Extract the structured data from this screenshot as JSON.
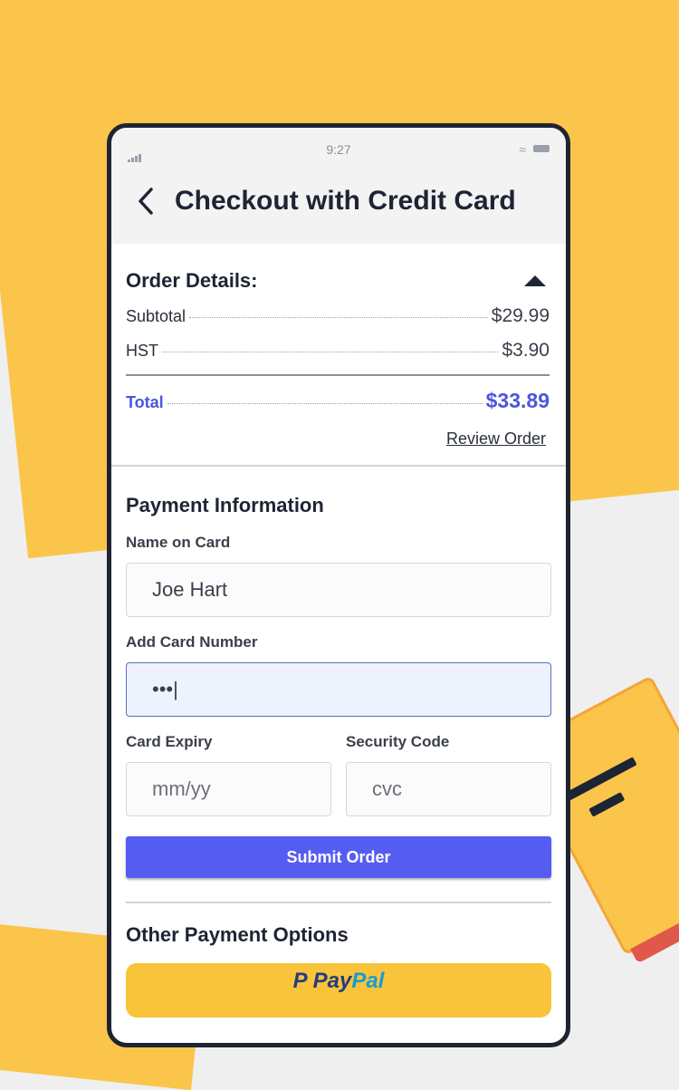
{
  "status": {
    "time": "9:27"
  },
  "header": {
    "title": "Checkout with Credit Card"
  },
  "order": {
    "title": "Order Details:",
    "lines": [
      {
        "label": "Subtotal",
        "value": "$29.99"
      },
      {
        "label": "HST",
        "value": "$3.90"
      }
    ],
    "total": {
      "label": "Total",
      "value": "$33.89"
    },
    "review_link": "Review Order"
  },
  "payment": {
    "title": "Payment Information",
    "name_label": "Name on Card",
    "name_value": "Joe Hart",
    "card_label": "Add Card Number",
    "card_value": "•••|",
    "expiry_label": "Card Expiry",
    "expiry_placeholder": "mm/yy",
    "security_label": "Security Code",
    "security_placeholder": "cvc",
    "submit_label": "Submit Order"
  },
  "other": {
    "title": "Other Payment Options",
    "paypal_pay": "Pay",
    "paypal_pal": "Pal"
  },
  "colors": {
    "accent": "#555cf2",
    "background_yellow": "#fbc54b",
    "total": "#4b57d9"
  }
}
